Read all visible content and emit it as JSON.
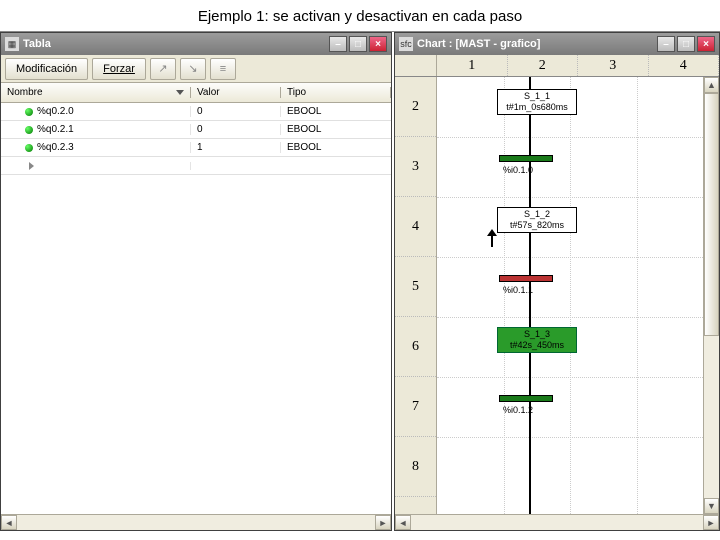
{
  "caption": "Ejemplo 1:  se activan y desactivan en cada paso",
  "left": {
    "title": "Tabla",
    "app_icon": "table-icon",
    "toolbar": {
      "modificacion": "Modificación",
      "forzar": "Forzar"
    },
    "columns": {
      "nombre": "Nombre",
      "valor": "Valor",
      "tipo": "Tipo"
    },
    "rows": [
      {
        "name": "%q0.2.0",
        "valor": "0",
        "tipo": "EBOOL"
      },
      {
        "name": "%q0.2.1",
        "valor": "0",
        "tipo": "EBOOL"
      },
      {
        "name": "%q0.2.3",
        "valor": "1",
        "tipo": "EBOOL"
      }
    ]
  },
  "right": {
    "title": "Chart : [MAST - grafico]",
    "app_icon": "sfc-icon",
    "col_headers": [
      "1",
      "2",
      "3",
      "4"
    ],
    "row_headers": [
      "2",
      "3",
      "4",
      "5",
      "6",
      "7",
      "8"
    ],
    "steps": [
      {
        "id": "S_1_1",
        "time": "t#1m_0s680ms",
        "active": false,
        "row": 0
      },
      {
        "id": "S_1_2",
        "time": "t#57s_820ms",
        "active": false,
        "row": 2
      },
      {
        "id": "S_1_3",
        "time": "t#42s_450ms",
        "active": true,
        "row": 4
      }
    ],
    "transitions": [
      {
        "label": "%i0.1.0",
        "row": 1,
        "color": "green"
      },
      {
        "label": "%i0.1.1",
        "row": 3,
        "color": "red"
      },
      {
        "label": "%i0.1.2",
        "row": 5,
        "color": "green"
      }
    ]
  }
}
